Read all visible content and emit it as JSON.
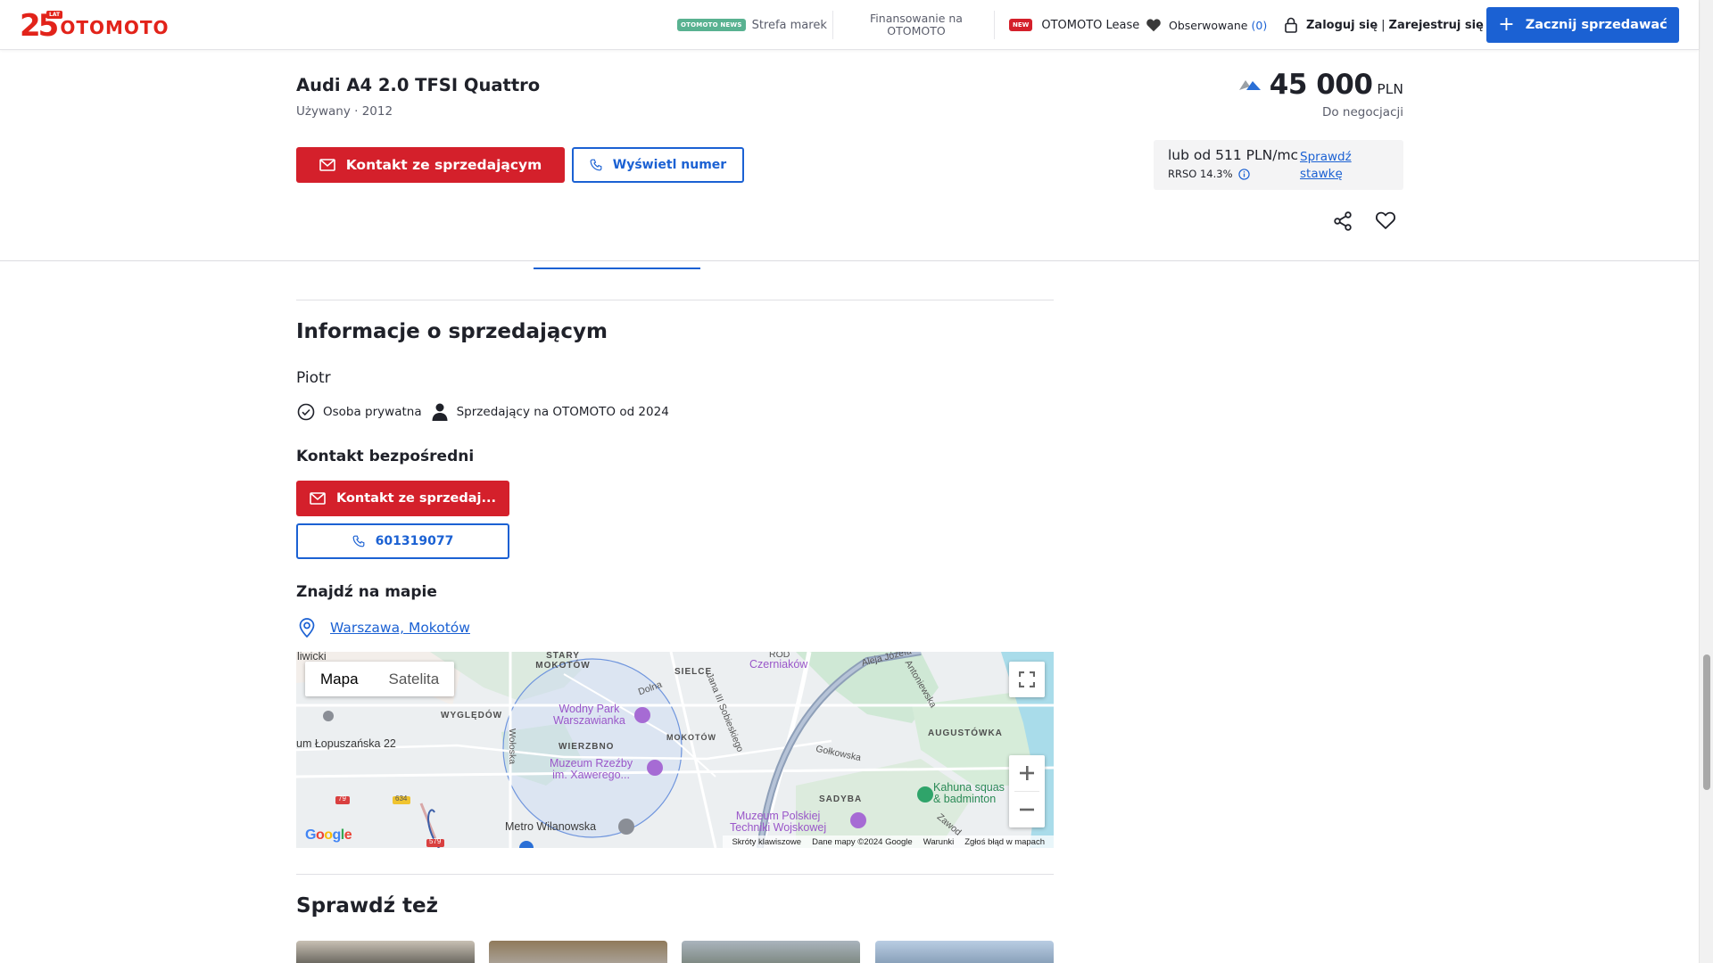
{
  "header": {
    "logo_number": "25",
    "logo_lat": "LAT",
    "logo_text": "OTOMOTO",
    "news_badge": "OTOMOTO NEWS",
    "nav_brands": "Strefa marek",
    "nav_financing": "Finansowanie na OTOMOTO",
    "new_badge": "NEW",
    "nav_lease": "OTOMOTO Lease",
    "nav_watched": "Obserwowane",
    "nav_watched_count": "(0)",
    "nav_login": "Zaloguj się",
    "nav_separator": "|",
    "nav_register": "Zarejestruj się",
    "sell_button": "Zacznij sprzedawać"
  },
  "listing": {
    "title": "Audi A4 2.0 TFSI Quattro",
    "subtitle": "Używany · 2012",
    "contact_button": "Kontakt ze sprzedającym",
    "show_number_button": "Wyświetl numer",
    "price_value": "45 000",
    "price_currency": "PLN",
    "price_note": "Do negocjacji",
    "financing_monthly": "lub od 511 PLN/mc",
    "financing_rrso": "RRSO 14.3%",
    "financing_link": "Sprawdź stawkę"
  },
  "seller": {
    "section_title": "Informacje o sprzedającym",
    "name": "Piotr",
    "type": "Osoba prywatna",
    "since": "Sprzedający na OTOMOTO od 2024",
    "direct_contact_title": "Kontakt bezpośredni",
    "contact_button": "Kontakt ze sprzedaj...",
    "phone": "601319077",
    "map_title": "Znajdź na mapie",
    "location": "Warszawa, Mokotów"
  },
  "map": {
    "type_map": "Mapa",
    "type_satellite": "Satelita",
    "labels": {
      "stary_mokotow": "STARY MOKOTÓW",
      "sielce": "SIELCE",
      "czerniakow": "Czerniaków",
      "rod": "ROD",
      "aleja": "Aleja Józefa",
      "antoniewska": "Antoniewska",
      "dolna": "Dolna",
      "sobieskiego": "Jana III Sobieskiego",
      "wygledow": "WYGLĘDÓW",
      "wodny_park_1": "Wodny Park",
      "wodny_park_2": "Warszawianka",
      "mokotow": "MOKOTÓW",
      "augustowka": "AUGUSTÓWKA",
      "wierzbno": "WIERZBNO",
      "muzeum_rzezby_1": "Muzeum Rzeźby",
      "muzeum_rzezby_2": "im. Xawerego...",
      "golkowska": "Gołkowska",
      "woloska": "Wołoska",
      "lopuszanska": "um Łopuszańska 22",
      "sadyba": "SADYBA",
      "kahuna_1": "Kahuna squas",
      "kahuna_2": "& badminton",
      "metro": "Metro Wilanowska",
      "muzeum_polskiej_1": "Muzeum Polskiej",
      "muzeum_polskiej_2": "Techniki Wojskowej",
      "zawod": "Zawod",
      "lwicki": "liwicki",
      "road_79": "79",
      "road_634": "634",
      "road_579": "579"
    },
    "google": "Google",
    "attr_shortcuts": "Skróty klawiszowe",
    "attr_data": "Dane mapy ©2024 Google",
    "attr_terms": "Warunki",
    "attr_report": "Zgłoś błąd w mapach"
  },
  "related": {
    "title": "Sprawdź też"
  },
  "colors": {
    "brand_red": "#d4202b",
    "brand_blue": "#1b61d3"
  }
}
